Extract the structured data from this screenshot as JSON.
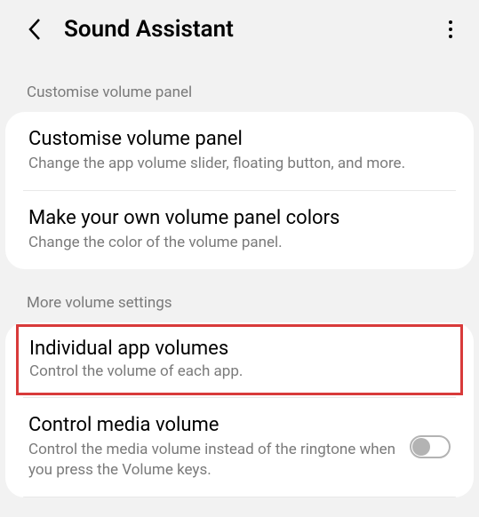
{
  "header": {
    "title": "Sound Assistant"
  },
  "sections": {
    "customise": {
      "label": "Customise volume panel",
      "items": [
        {
          "title": "Customise volume panel",
          "desc": "Change the app volume slider, floating button, and more."
        },
        {
          "title": "Make your own volume panel colors",
          "desc": "Change the color of the volume panel."
        }
      ]
    },
    "more": {
      "label": "More volume settings",
      "items": [
        {
          "title": "Individual app volumes",
          "desc": "Control the volume of each app."
        },
        {
          "title": "Control media volume",
          "desc": "Control the media volume instead of the ringtone when you press the Volume keys."
        }
      ]
    }
  }
}
